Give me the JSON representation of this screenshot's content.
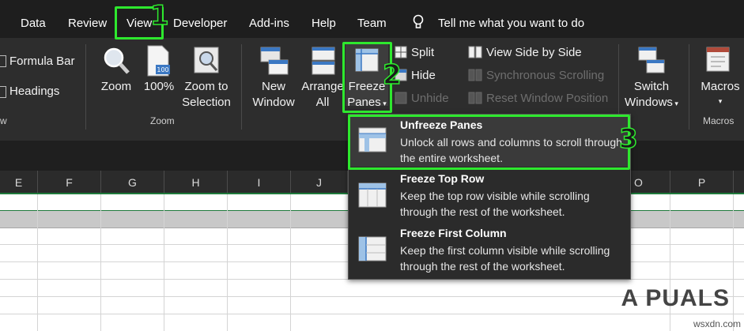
{
  "menu": {
    "tabs": [
      "Data",
      "Review",
      "View",
      "Developer",
      "Add-ins",
      "Help",
      "Team"
    ],
    "active_tab": "View",
    "tell_me": "Tell me what you want to do"
  },
  "ribbon": {
    "show": {
      "formula_bar": "Formula Bar",
      "headings": "Headings",
      "group_tail": "w"
    },
    "zoom_group": {
      "zoom": "Zoom",
      "hundred": "100%",
      "hundred_badge": "100",
      "zoom_selection_line1": "Zoom to",
      "zoom_selection_line2": "Selection",
      "group_label": "Zoom"
    },
    "window_group": {
      "new_window_line1": "New",
      "new_window_line2": "Window",
      "arrange_all_line1": "Arrange",
      "arrange_all_line2": "All",
      "freeze_panes_line1": "Freeze",
      "freeze_panes_line2": "Panes",
      "split": "Split",
      "hide": "Hide",
      "unhide": "Unhide",
      "view_side_by_side": "View Side by Side",
      "synchronous_scrolling": "Synchronous Scrolling",
      "reset_window_position": "Reset Window Position",
      "switch_windows_line1": "Switch",
      "switch_windows_line2": "Windows"
    },
    "macros_group": {
      "macros": "Macros",
      "group_label": "Macros"
    }
  },
  "columns": [
    "E",
    "F",
    "G",
    "H",
    "I",
    "J",
    "O",
    "P"
  ],
  "dropdown": {
    "items": [
      {
        "title": "Unfreeze Panes",
        "desc": "Unlock all rows and columns to scroll through the entire worksheet."
      },
      {
        "title": "Freeze Top Row",
        "desc": "Keep the top row visible while scrolling through the rest of the worksheet."
      },
      {
        "title": "Freeze First Column",
        "desc": "Keep the first column visible while scrolling through the rest of the worksheet."
      }
    ]
  },
  "annotations": {
    "step1": "1",
    "step2": "2",
    "step3": "3",
    "highlight_color": "#2ee82e"
  },
  "branding": {
    "logo": "A  PUALS",
    "watermark": "wsxdn.com"
  },
  "colors": {
    "menu_bg": "#1e1e1e",
    "ribbon_bg": "#2d2d2d",
    "grid_accent": "#1f7a3c"
  }
}
